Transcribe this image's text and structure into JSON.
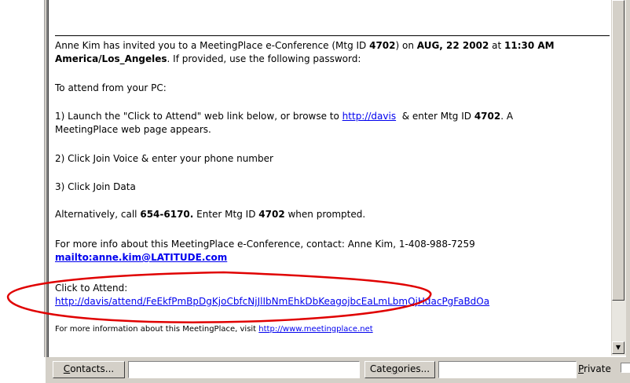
{
  "message": {
    "invite_line_prefix": "Anne Kim has invited you to a MeetingPlace e-Conference (Mtg ID ",
    "mtg_id": "4702",
    "invite_line_mid": ") on ",
    "date": "AUG, 22 2002",
    "invite_line_at": " at ",
    "time": "11:30 AM",
    "timezone": "America/Los_Angeles",
    "invite_line_suffix": ". If provided, use the following password:",
    "attend_pc": "To attend from your PC:",
    "step1_prefix": "1) Launch the \"Click to Attend\" web link below, or browse to ",
    "step1_link": "http://davis",
    "step1_mid": "  & enter Mtg ID ",
    "step1_suffix": ". A",
    "step1_line2": "MeetingPlace web page appears.",
    "step2": "2) Click Join Voice & enter your phone number",
    "step3": "3) Click Join Data",
    "alt_prefix": "Alternatively, call ",
    "alt_phone": "654-6170.",
    "alt_mid": " Enter Mtg ID ",
    "alt_suffix": " when prompted.",
    "info_line": "For more info about this MeetingPlace e-Conference, contact: Anne Kim, 1-408-988-7259",
    "mailto": "mailto:anne.kim@LATITUDE.com",
    "click_to_attend": "Click to Attend:",
    "attend_url": "http://davis/attend/FeEkfPmBpDgKjoCbfcNjJlIbNmEhkDbKeagojbcEaLmLbmOjHdacPgFaBdOa",
    "more_info_prefix": "For more information about this MeetingPlace, visit ",
    "more_info_link": "http://www.meetingplace.net"
  },
  "bottombar": {
    "contacts_label": "Contacts...",
    "contacts_value": "",
    "categories_label": "Categories...",
    "categories_value": "",
    "private_label": "Private",
    "private_checked": false
  },
  "annotation_color": "#e00000"
}
